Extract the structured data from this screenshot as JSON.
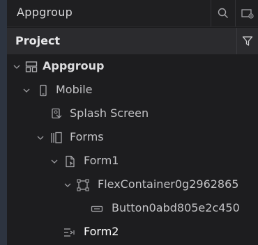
{
  "header": {
    "title": "Appgroup",
    "search_icon": "search-icon",
    "settings_icon": "settings-icon"
  },
  "project": {
    "title": "Project",
    "filter_icon": "filter-icon"
  },
  "tree": [
    {
      "label": "Appgroup",
      "icon": "app-group-icon",
      "expanded": true
    },
    {
      "label": "Mobile",
      "icon": "mobile-device-icon",
      "expanded": true
    },
    {
      "label": "Splash Screen",
      "icon": "splash-screen-icon"
    },
    {
      "label": "Forms",
      "icon": "forms-icon",
      "expanded": true
    },
    {
      "label": "Form1",
      "icon": "form-icon",
      "expanded": true
    },
    {
      "label": "FlexContainer0g2962865",
      "icon": "flex-container-icon",
      "expanded": true
    },
    {
      "label": "Button0abd805e2c450",
      "icon": "button-widget-icon"
    },
    {
      "label": "Form2",
      "icon": "form-list-icon",
      "selected": true
    }
  ],
  "colors": {
    "panel_bg": "#1d1d1f",
    "project_bar_bg": "#2b2b2e",
    "text": "#c3c3c6",
    "icon": "#9a9a9e"
  }
}
